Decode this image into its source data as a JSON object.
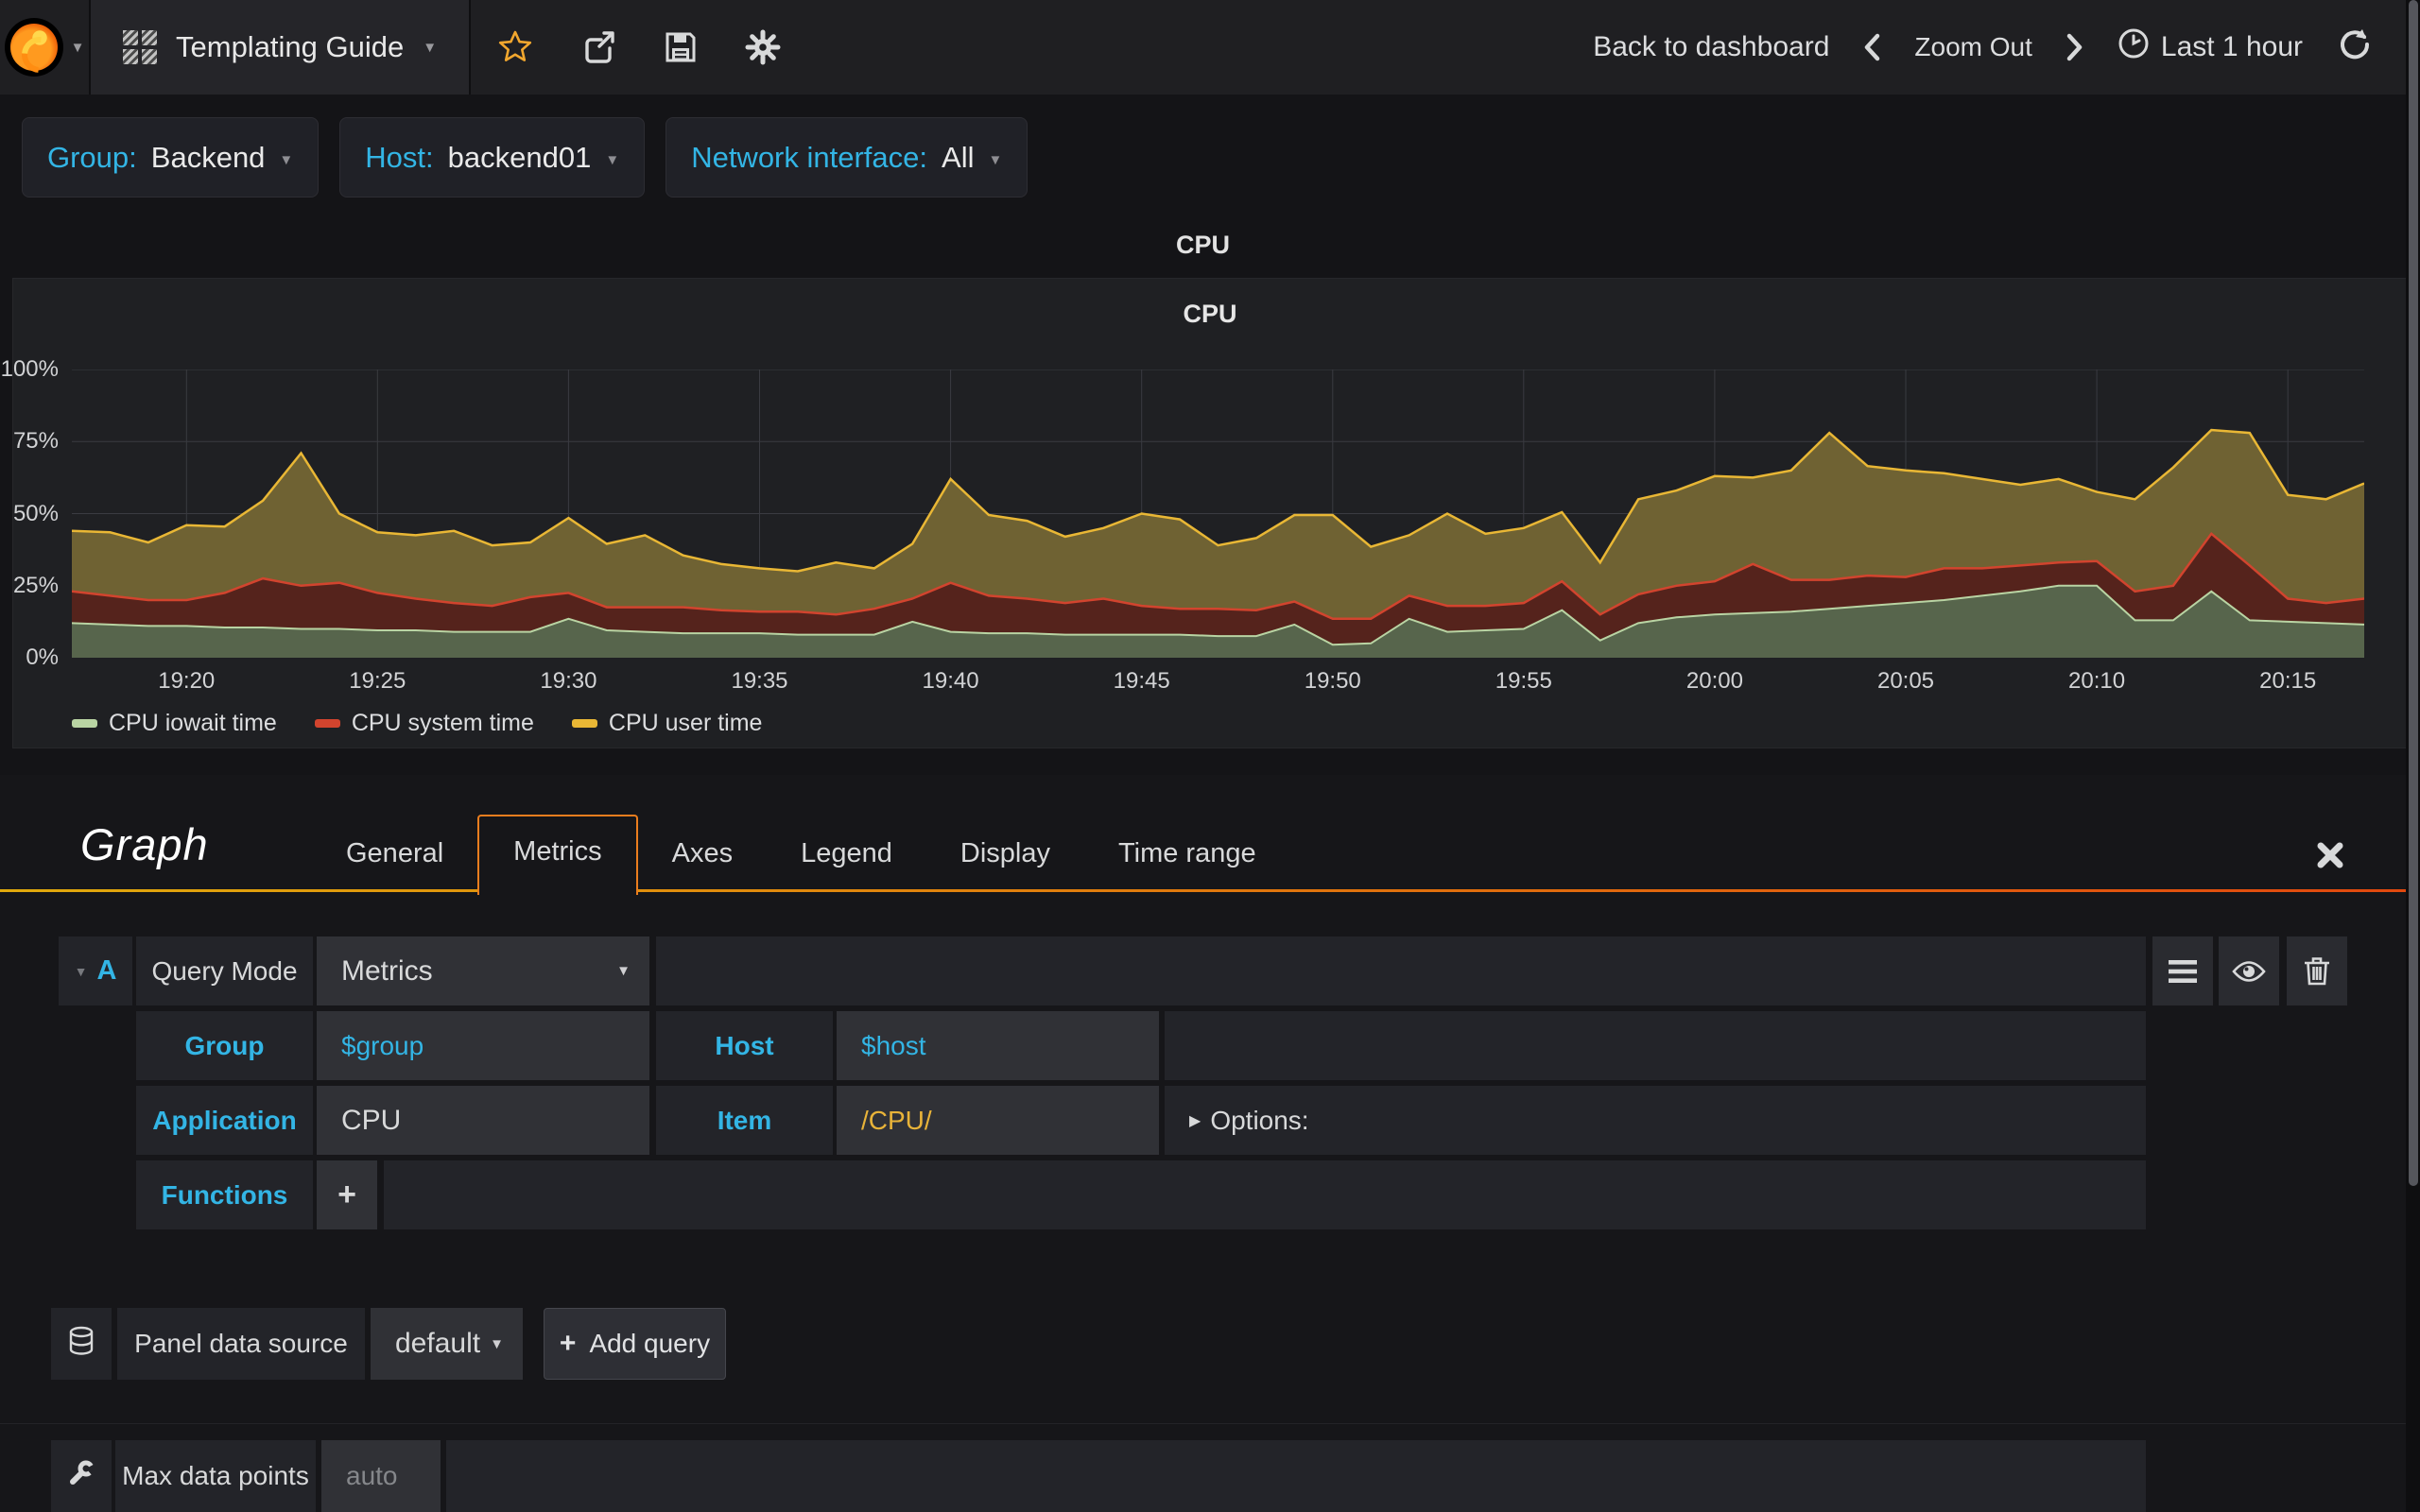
{
  "navbar": {
    "dashboard_title": "Templating Guide",
    "back_to_dashboard": "Back to dashboard",
    "zoom_out": "Zoom Out",
    "time_range": "Last 1 hour"
  },
  "variables": [
    {
      "label": "Group:",
      "value": "Backend"
    },
    {
      "label": "Host:",
      "value": "backend01"
    },
    {
      "label": "Network interface:",
      "value": "All"
    }
  ],
  "row_title": "CPU",
  "panel": {
    "title": "CPU"
  },
  "chart_data": {
    "type": "area",
    "stacked": true,
    "title": "CPU",
    "ylabel": "",
    "xlabel": "",
    "ylim": [
      0,
      100
    ],
    "grid": true,
    "legend_position": "bottom-left",
    "x": [
      "19:17",
      "19:18",
      "19:19",
      "19:20",
      "19:21",
      "19:22",
      "19:23",
      "19:24",
      "19:25",
      "19:26",
      "19:27",
      "19:28",
      "19:29",
      "19:30",
      "19:31",
      "19:32",
      "19:33",
      "19:34",
      "19:35",
      "19:36",
      "19:37",
      "19:38",
      "19:39",
      "19:40",
      "19:41",
      "19:42",
      "19:43",
      "19:44",
      "19:45",
      "19:46",
      "19:47",
      "19:48",
      "19:49",
      "19:50",
      "19:51",
      "19:52",
      "19:53",
      "19:54",
      "19:55",
      "19:56",
      "19:57",
      "19:58",
      "19:59",
      "20:00",
      "20:01",
      "20:02",
      "20:03",
      "20:04",
      "20:05",
      "20:06",
      "20:07",
      "20:08",
      "20:09",
      "20:10",
      "20:11",
      "20:12",
      "20:13",
      "20:14",
      "20:15",
      "20:16",
      "20:17"
    ],
    "series": [
      {
        "name": "CPU iowait time",
        "line_color": "#b9d4a3",
        "fill_color": "#57654c",
        "values": [
          12,
          11.5,
          11,
          11,
          10.5,
          10.5,
          10,
          10,
          9.5,
          9.5,
          9,
          9,
          9,
          13.5,
          9.5,
          9,
          8.5,
          8.5,
          8.5,
          8,
          8,
          8,
          12.5,
          9,
          8.5,
          8.5,
          8,
          8,
          8,
          8,
          7.5,
          7.5,
          11.5,
          4.5,
          5,
          13.5,
          9,
          9.5,
          10,
          16.5,
          6,
          12,
          14,
          15,
          15.5,
          16,
          17,
          18,
          19,
          20,
          21.5,
          23,
          25,
          25,
          13,
          13,
          23,
          13,
          12.5,
          12,
          11.5
        ]
      },
      {
        "name": "CPU system time",
        "line_color": "#d2442e",
        "fill_color": "#55231c",
        "values": [
          11,
          10,
          9,
          9,
          12,
          17,
          15,
          16,
          13,
          11,
          10,
          9,
          12,
          9,
          8,
          8.5,
          9,
          8,
          7.5,
          8,
          7,
          9,
          8,
          17,
          13,
          12,
          11,
          12.5,
          10,
          9,
          9.5,
          9,
          8,
          9,
          8.5,
          8,
          9,
          8.5,
          9,
          10,
          9,
          10,
          11,
          11.5,
          17,
          11,
          10,
          10.5,
          9,
          11,
          9.5,
          9,
          8,
          8.5,
          10,
          12,
          20,
          19,
          8,
          7,
          9
        ]
      },
      {
        "name": "CPU user time",
        "line_color": "#e9b735",
        "fill_color": "#6f6233",
        "values": [
          21,
          22,
          20,
          26,
          23,
          27,
          46,
          24,
          21,
          22,
          25,
          21,
          19,
          26,
          22,
          25,
          18,
          16,
          15,
          14,
          18,
          14,
          19,
          36,
          28,
          27,
          23,
          24.5,
          32,
          31,
          22,
          25,
          30,
          36,
          25,
          21,
          32,
          25,
          26,
          24,
          18,
          33,
          33,
          36.5,
          30,
          38,
          51,
          38,
          37,
          33,
          31,
          28,
          29,
          24,
          32,
          41,
          36,
          46,
          36,
          36,
          40
        ]
      }
    ],
    "xticks": [
      "19:20",
      "19:25",
      "19:30",
      "19:35",
      "19:40",
      "19:45",
      "19:50",
      "19:55",
      "20:00",
      "20:05",
      "20:10",
      "20:15"
    ],
    "yticks": [
      {
        "value": 0,
        "label": "0%"
      },
      {
        "value": 25,
        "label": "25%"
      },
      {
        "value": 50,
        "label": "50%"
      },
      {
        "value": 75,
        "label": "75%"
      },
      {
        "value": 100,
        "label": "100%"
      }
    ]
  },
  "editor": {
    "panel_type": "Graph",
    "tabs": [
      "General",
      "Metrics",
      "Axes",
      "Legend",
      "Display",
      "Time range"
    ],
    "active_tab": "Metrics",
    "query": {
      "letter": "A",
      "mode_label": "Query Mode",
      "mode_value": "Metrics",
      "group_label": "Group",
      "group_value": "$group",
      "host_label": "Host",
      "host_value": "$host",
      "application_label": "Application",
      "application_value": "CPU",
      "item_label": "Item",
      "item_value": "/CPU/",
      "options_label": "Options:",
      "functions_label": "Functions",
      "add_function": "+"
    },
    "datasource": {
      "label": "Panel data source",
      "value": "default",
      "plus": "+",
      "add_query": "Add query"
    },
    "max_data_points": {
      "label": "Max data points",
      "placeholder": "auto"
    }
  },
  "colors": {
    "accent_blue": "#33b5e5",
    "accent_orange": "#ea7d1e",
    "star_orange": "#f2a72e",
    "item_regex_gold": "#e8b339"
  }
}
